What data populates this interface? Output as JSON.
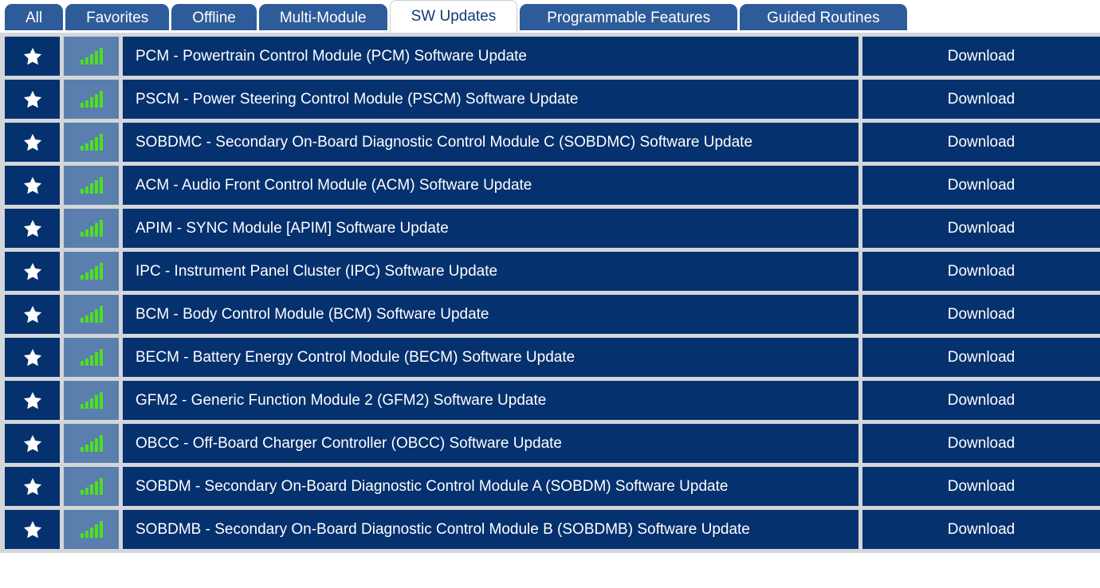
{
  "colors": {
    "tab_inactive_bg": "#2e5c9a",
    "tab_active_bg": "#ffffff",
    "tab_active_text": "#123a7a",
    "row_bg": "#05316e",
    "signal_cell_bg": "#5a7eae",
    "table_gap": "#d3d6da",
    "signal_bar": "#4de01e",
    "star": "#ffffff",
    "row_text": "#ffffff"
  },
  "tabs": [
    {
      "label": "All",
      "active": false
    },
    {
      "label": "Favorites",
      "active": false
    },
    {
      "label": "Offline",
      "active": false
    },
    {
      "label": "Multi-Module",
      "active": false
    },
    {
      "label": "SW Updates",
      "active": true
    },
    {
      "label": "Programmable Features",
      "active": false
    },
    {
      "label": "Guided Routines",
      "active": false
    }
  ],
  "table": {
    "favorite_icon": "star-icon",
    "signal_icon": "signal-bars-icon",
    "action_label": "Download",
    "rows": [
      {
        "name": "PCM - Powertrain Control Module (PCM) Software Update",
        "action": "Download"
      },
      {
        "name": "PSCM - Power Steering Control Module (PSCM) Software Update",
        "action": "Download"
      },
      {
        "name": "SOBDMC - Secondary On-Board Diagnostic Control Module C (SOBDMC) Software Update",
        "action": "Download"
      },
      {
        "name": "ACM - Audio Front Control Module (ACM) Software Update",
        "action": "Download"
      },
      {
        "name": "APIM - SYNC Module [APIM] Software Update",
        "action": "Download"
      },
      {
        "name": "IPC - Instrument Panel Cluster (IPC) Software Update",
        "action": "Download"
      },
      {
        "name": "BCM - Body Control Module (BCM) Software Update",
        "action": "Download"
      },
      {
        "name": "BECM - Battery Energy Control Module (BECM) Software Update",
        "action": "Download"
      },
      {
        "name": "GFM2 - Generic Function Module 2 (GFM2) Software Update",
        "action": "Download"
      },
      {
        "name": "OBCC - Off-Board Charger Controller (OBCC) Software Update",
        "action": "Download"
      },
      {
        "name": "SOBDM - Secondary On-Board Diagnostic Control Module A (SOBDM) Software Update",
        "action": "Download"
      },
      {
        "name": "SOBDMB - Secondary On-Board Diagnostic Control Module B (SOBDMB) Software Update",
        "action": "Download"
      }
    ]
  }
}
